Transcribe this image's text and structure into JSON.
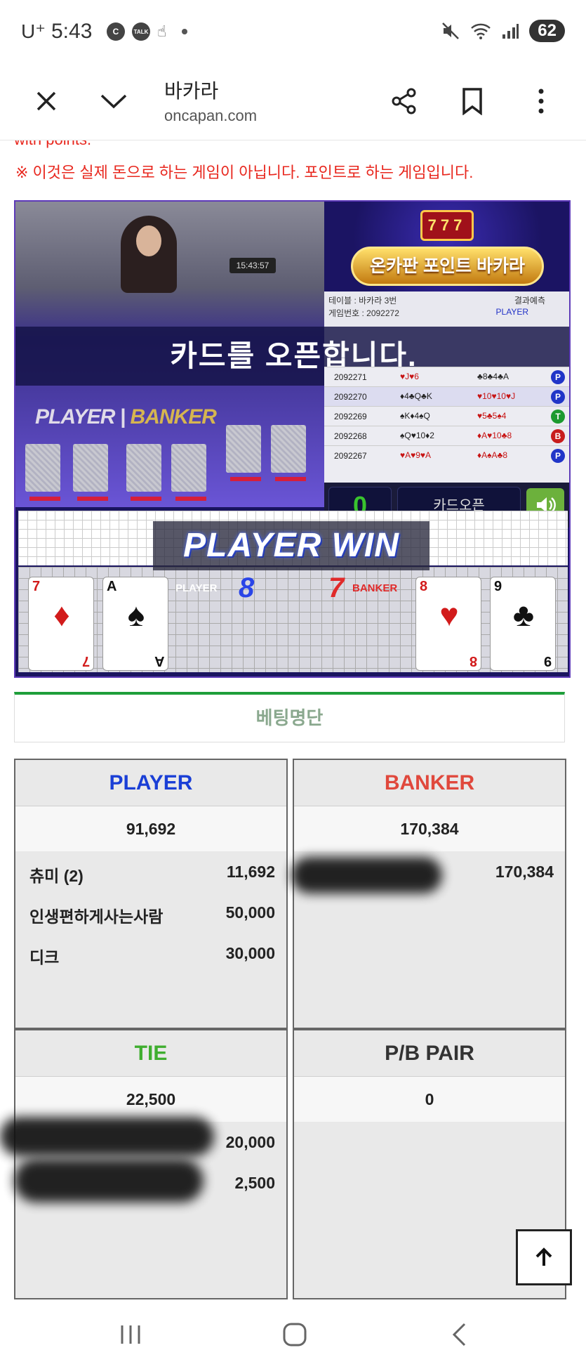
{
  "status_bar": {
    "carrier": "U⁺",
    "time": "5:43",
    "notif_c": "C",
    "notif_talk": "TALK",
    "battery": "62"
  },
  "browser": {
    "title": "바카라",
    "url": "oncapan.com"
  },
  "page": {
    "cut_text": "with points.",
    "notice": "※ 이것은 실제 돈으로 하는 게임이 아닙니다. 포인트로 하는 게임입니다."
  },
  "game": {
    "clock": "15:43:57",
    "pb_player": "PLAYER",
    "pb_banker": "BANKER",
    "announce": "카드를 오픈합니다.",
    "logo_text": "온카판 포인트 바카라",
    "slot": "777",
    "table_label": "테이블 : 바카라 3번",
    "predict_label": "결과예측",
    "game_no": "게임번호 : 2092272",
    "player_small": "PLAYER",
    "history": [
      {
        "id": "2092271",
        "player": "♥J♥6",
        "banker": "♣8♣4♣A",
        "result": "P"
      },
      {
        "id": "2092270",
        "player": "♦4♣Q♣K",
        "banker": "♥10♥10♥J",
        "result": "P"
      },
      {
        "id": "2092269",
        "player": "♠K♦4♠Q",
        "banker": "♥5♣5♠4",
        "result": "T"
      },
      {
        "id": "2092268",
        "player": "♠Q♥10♦2",
        "banker": "♦A♥10♣8",
        "result": "B"
      },
      {
        "id": "2092267",
        "player": "♥A♥9♥A",
        "banker": "♦A♠A♣8",
        "result": "P"
      }
    ],
    "counter": "0",
    "open_button": "카드오픈",
    "win_banner": "PLAYER WIN",
    "player_label": "PLAYER",
    "player_score": "8",
    "banker_label": "BANKER",
    "banker_score": "7",
    "cards": [
      {
        "rank": "7",
        "suit": "♦",
        "color": "red"
      },
      {
        "rank": "A",
        "suit": "♠",
        "color": "black"
      },
      {
        "rank": "8",
        "suit": "♥",
        "color": "red"
      },
      {
        "rank": "9",
        "suit": "♣",
        "color": "black"
      }
    ]
  },
  "betting": {
    "title": "베팅명단",
    "player": {
      "label": "PLAYER",
      "color": "#1a3fd6",
      "total": "91,692",
      "rows": [
        {
          "name": "츄미 (2)",
          "amount": "11,692"
        },
        {
          "name": "인생편하게사는사람",
          "amount": "50,000"
        },
        {
          "name": "디크",
          "amount": "30,000"
        }
      ]
    },
    "banker": {
      "label": "BANKER",
      "color": "#e0483c",
      "total": "170,384",
      "rows": [
        {
          "name": "",
          "amount": "170,384"
        }
      ]
    },
    "tie": {
      "label": "TIE",
      "color": "#3fae2f",
      "total": "22,500",
      "rows": [
        {
          "name": "",
          "amount": "20,000"
        },
        {
          "name": "",
          "amount": "2,500"
        }
      ]
    },
    "pair": {
      "label": "P/B PAIR",
      "color": "#333333",
      "total": "0"
    }
  }
}
